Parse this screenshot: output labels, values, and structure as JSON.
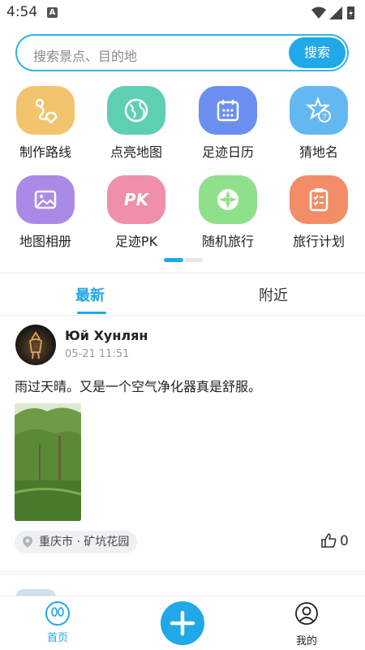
{
  "status_bar": {
    "time": "4:54",
    "notification_badge": "A"
  },
  "search": {
    "placeholder": "搜索景点、目的地",
    "button_label": "搜索"
  },
  "grid": {
    "items": [
      {
        "label": "制作路线",
        "icon": "route-icon",
        "color": "#f2c46d"
      },
      {
        "label": "点亮地图",
        "icon": "globe-icon",
        "color": "#5fcfb3"
      },
      {
        "label": "足迹日历",
        "icon": "calendar-icon",
        "color": "#6b8ff0"
      },
      {
        "label": "猜地名",
        "icon": "star-question-icon",
        "color": "#63b8f2"
      },
      {
        "label": "地图相册",
        "icon": "photo-icon",
        "color": "#a98ae6"
      },
      {
        "label": "足迹PK",
        "icon": "pk-icon",
        "color": "#ef8fa9"
      },
      {
        "label": "随机旅行",
        "icon": "wheel-icon",
        "color": "#8ee08a"
      },
      {
        "label": "旅行计划",
        "icon": "checklist-icon",
        "color": "#f28d67"
      }
    ]
  },
  "tabs": [
    {
      "label": "最新",
      "active": true
    },
    {
      "label": "附近",
      "active": false
    }
  ],
  "post": {
    "user": "Юй Хунлян",
    "time": "05-21 11:51",
    "text": "雨过天晴。又是一个空气净化器真是舒服。",
    "location": "重庆市 · 矿坑花园",
    "likes": "0"
  },
  "bottom_nav": {
    "home": "首页",
    "mine": "我的"
  },
  "colors": {
    "accent": "#20a8e8"
  }
}
